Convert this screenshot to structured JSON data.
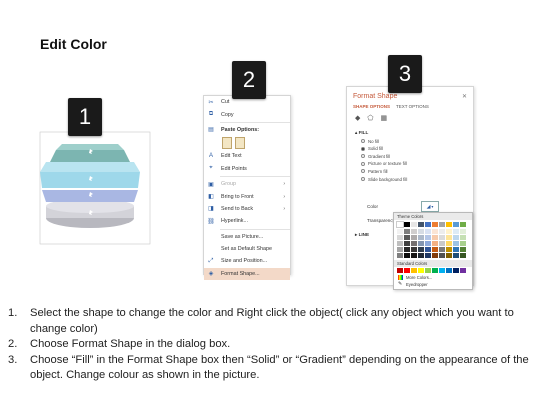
{
  "title": "Edit Color",
  "badges": [
    "1",
    "2",
    "3"
  ],
  "context_menu": {
    "items": [
      {
        "label": "Cut",
        "icon": "scissors-icon",
        "glyph": "✂",
        "state": "normal",
        "arrow": ""
      },
      {
        "label": "Copy",
        "icon": "copy-icon",
        "glyph": "⧉",
        "state": "normal",
        "arrow": ""
      },
      {
        "label": "Paste Options:",
        "icon": "paste-icon",
        "glyph": "▤",
        "state": "header",
        "arrow": ""
      },
      {
        "label": "Edit Text",
        "icon": "edit-text-icon",
        "glyph": "A",
        "state": "normal",
        "arrow": ""
      },
      {
        "label": "Edit Points",
        "icon": "edit-points-icon",
        "glyph": "⌖",
        "state": "normal",
        "arrow": ""
      },
      {
        "label": "Group",
        "icon": "group-icon",
        "glyph": "▣",
        "state": "disabled",
        "arrow": "›"
      },
      {
        "label": "Bring to Front",
        "icon": "bring-front-icon",
        "glyph": "◧",
        "state": "normal",
        "arrow": "›"
      },
      {
        "label": "Send to Back",
        "icon": "send-back-icon",
        "glyph": "◨",
        "state": "normal",
        "arrow": "›"
      },
      {
        "label": "Hyperlink...",
        "icon": "hyperlink-icon",
        "glyph": "⛓",
        "state": "normal",
        "arrow": ""
      },
      {
        "label": "Save as Picture...",
        "icon": "",
        "glyph": "",
        "state": "normal",
        "arrow": ""
      },
      {
        "label": "Set as Default Shape",
        "icon": "",
        "glyph": "",
        "state": "normal",
        "arrow": ""
      },
      {
        "label": "Size and Position...",
        "icon": "size-position-icon",
        "glyph": "⤢",
        "state": "normal",
        "arrow": ""
      },
      {
        "label": "Format Shape...",
        "icon": "format-shape-icon",
        "glyph": "◈",
        "state": "highlighted",
        "arrow": ""
      }
    ]
  },
  "format_shape": {
    "title": "Format Shape",
    "close": "✕",
    "tabs": [
      "SHAPE OPTIONS",
      "TEXT OPTIONS"
    ],
    "fill_label": "FILL",
    "fill_options": [
      {
        "label": "No fill",
        "kind": "radio",
        "on": false
      },
      {
        "label": "Solid fill",
        "kind": "radio",
        "on": true
      },
      {
        "label": "Gradient fill",
        "kind": "radio",
        "on": false
      },
      {
        "label": "Picture or texture fill",
        "kind": "radio",
        "on": false
      },
      {
        "label": "Pattern fill",
        "kind": "radio",
        "on": false
      },
      {
        "label": "Slide background fill",
        "kind": "radio",
        "on": false
      }
    ],
    "color_label": "Color",
    "transparency_label": "Transparency",
    "line_label": "LINE"
  },
  "palette": {
    "theme_label": "Theme Colors",
    "standard_label": "Standard Colors",
    "more_colors": "More Colors...",
    "eyedropper": "Eyedropper",
    "theme_top": [
      "#ffffff",
      "#000000",
      "#e7e6e6",
      "#44546a",
      "#4472c4",
      "#ed7d31",
      "#a5a5a5",
      "#ffc000",
      "#5b9bd5",
      "#70ad47"
    ],
    "theme_shades": [
      [
        "#f2f2f2",
        "#7f7f7f",
        "#d0cece",
        "#d6dce4",
        "#d9e2f3",
        "#fbe5d5",
        "#ededed",
        "#fff2cc",
        "#deebf6",
        "#e2efd9"
      ],
      [
        "#d8d8d8",
        "#595959",
        "#aeabab",
        "#adb9ca",
        "#b4c6e7",
        "#f7cbac",
        "#dbdbdb",
        "#fee599",
        "#bdd7ee",
        "#c5e0b3"
      ],
      [
        "#bfbfbf",
        "#3f3f3f",
        "#757070",
        "#8496b0",
        "#8eaadb",
        "#f4b183",
        "#c9c9c9",
        "#ffd965",
        "#9cc3e5",
        "#a8d08d"
      ],
      [
        "#a5a5a5",
        "#262626",
        "#3a3838",
        "#323f4f",
        "#2f5496",
        "#c55a11",
        "#7b7b7b",
        "#bf9000",
        "#2e75b5",
        "#538135"
      ],
      [
        "#7f7f7f",
        "#0c0c0c",
        "#171616",
        "#222a35",
        "#1f3864",
        "#833c0b",
        "#525252",
        "#7f6000",
        "#1e4e79",
        "#375623"
      ]
    ],
    "standard": [
      "#c00000",
      "#ff0000",
      "#ffc000",
      "#ffff00",
      "#92d050",
      "#00b050",
      "#00b0f0",
      "#0070c0",
      "#002060",
      "#7030a0"
    ]
  },
  "shape_stack": {
    "layers": [
      {
        "color": "#8fc3c0",
        "label": "teal-layer"
      },
      {
        "color": "#9ed8ea",
        "label": "light-blue-layer"
      },
      {
        "color": "#a9b7e3",
        "label": "periwinkle-layer"
      },
      {
        "color": "#cfcfd6",
        "label": "grey-layer"
      }
    ]
  },
  "steps": [
    {
      "num": "1.",
      "text": "Select the shape to change the color and Right click the object( click any object which you want to change color)"
    },
    {
      "num": "2.",
      "text": "Choose Format Shape in the dialog box."
    },
    {
      "num": "3.",
      "text": "Choose “Fill” in the Format Shape box then “Solid” or “Gradient” depending on the appearance of the object. Change colour as shown in the picture."
    }
  ]
}
